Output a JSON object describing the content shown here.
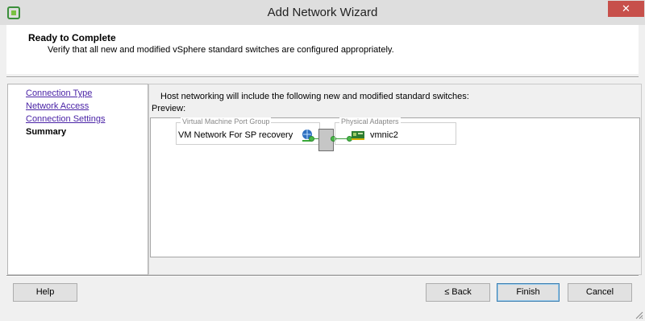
{
  "window": {
    "title": "Add Network Wizard",
    "close_glyph": "✕",
    "app_icon": "vsphere-client-icon"
  },
  "header": {
    "title": "Ready to Complete",
    "subtitle": "Verify that all new and modified vSphere standard switches are configured appropriately."
  },
  "nav": {
    "items": [
      {
        "label": "Connection Type",
        "state": "link"
      },
      {
        "label": "Network Access",
        "state": "link"
      },
      {
        "label": "Connection Settings",
        "state": "link"
      },
      {
        "label": "Summary",
        "state": "current"
      }
    ]
  },
  "panel": {
    "intro": "Host networking will include the following new and modified standard switches:",
    "preview_label": "Preview:",
    "vm_group_label": "Virtual Machine Port Group",
    "vm_port_group": "VM Network For SP recovery",
    "physical_group_label": "Physical Adapters",
    "physical_adapter": "vmnic2"
  },
  "footer": {
    "help": "Help",
    "back": "≤ Back",
    "finish": "Finish",
    "cancel": "Cancel"
  },
  "colors": {
    "nav_link": "#4a23a6",
    "connector_green": "#49b849",
    "close_button": "#c7504b"
  }
}
